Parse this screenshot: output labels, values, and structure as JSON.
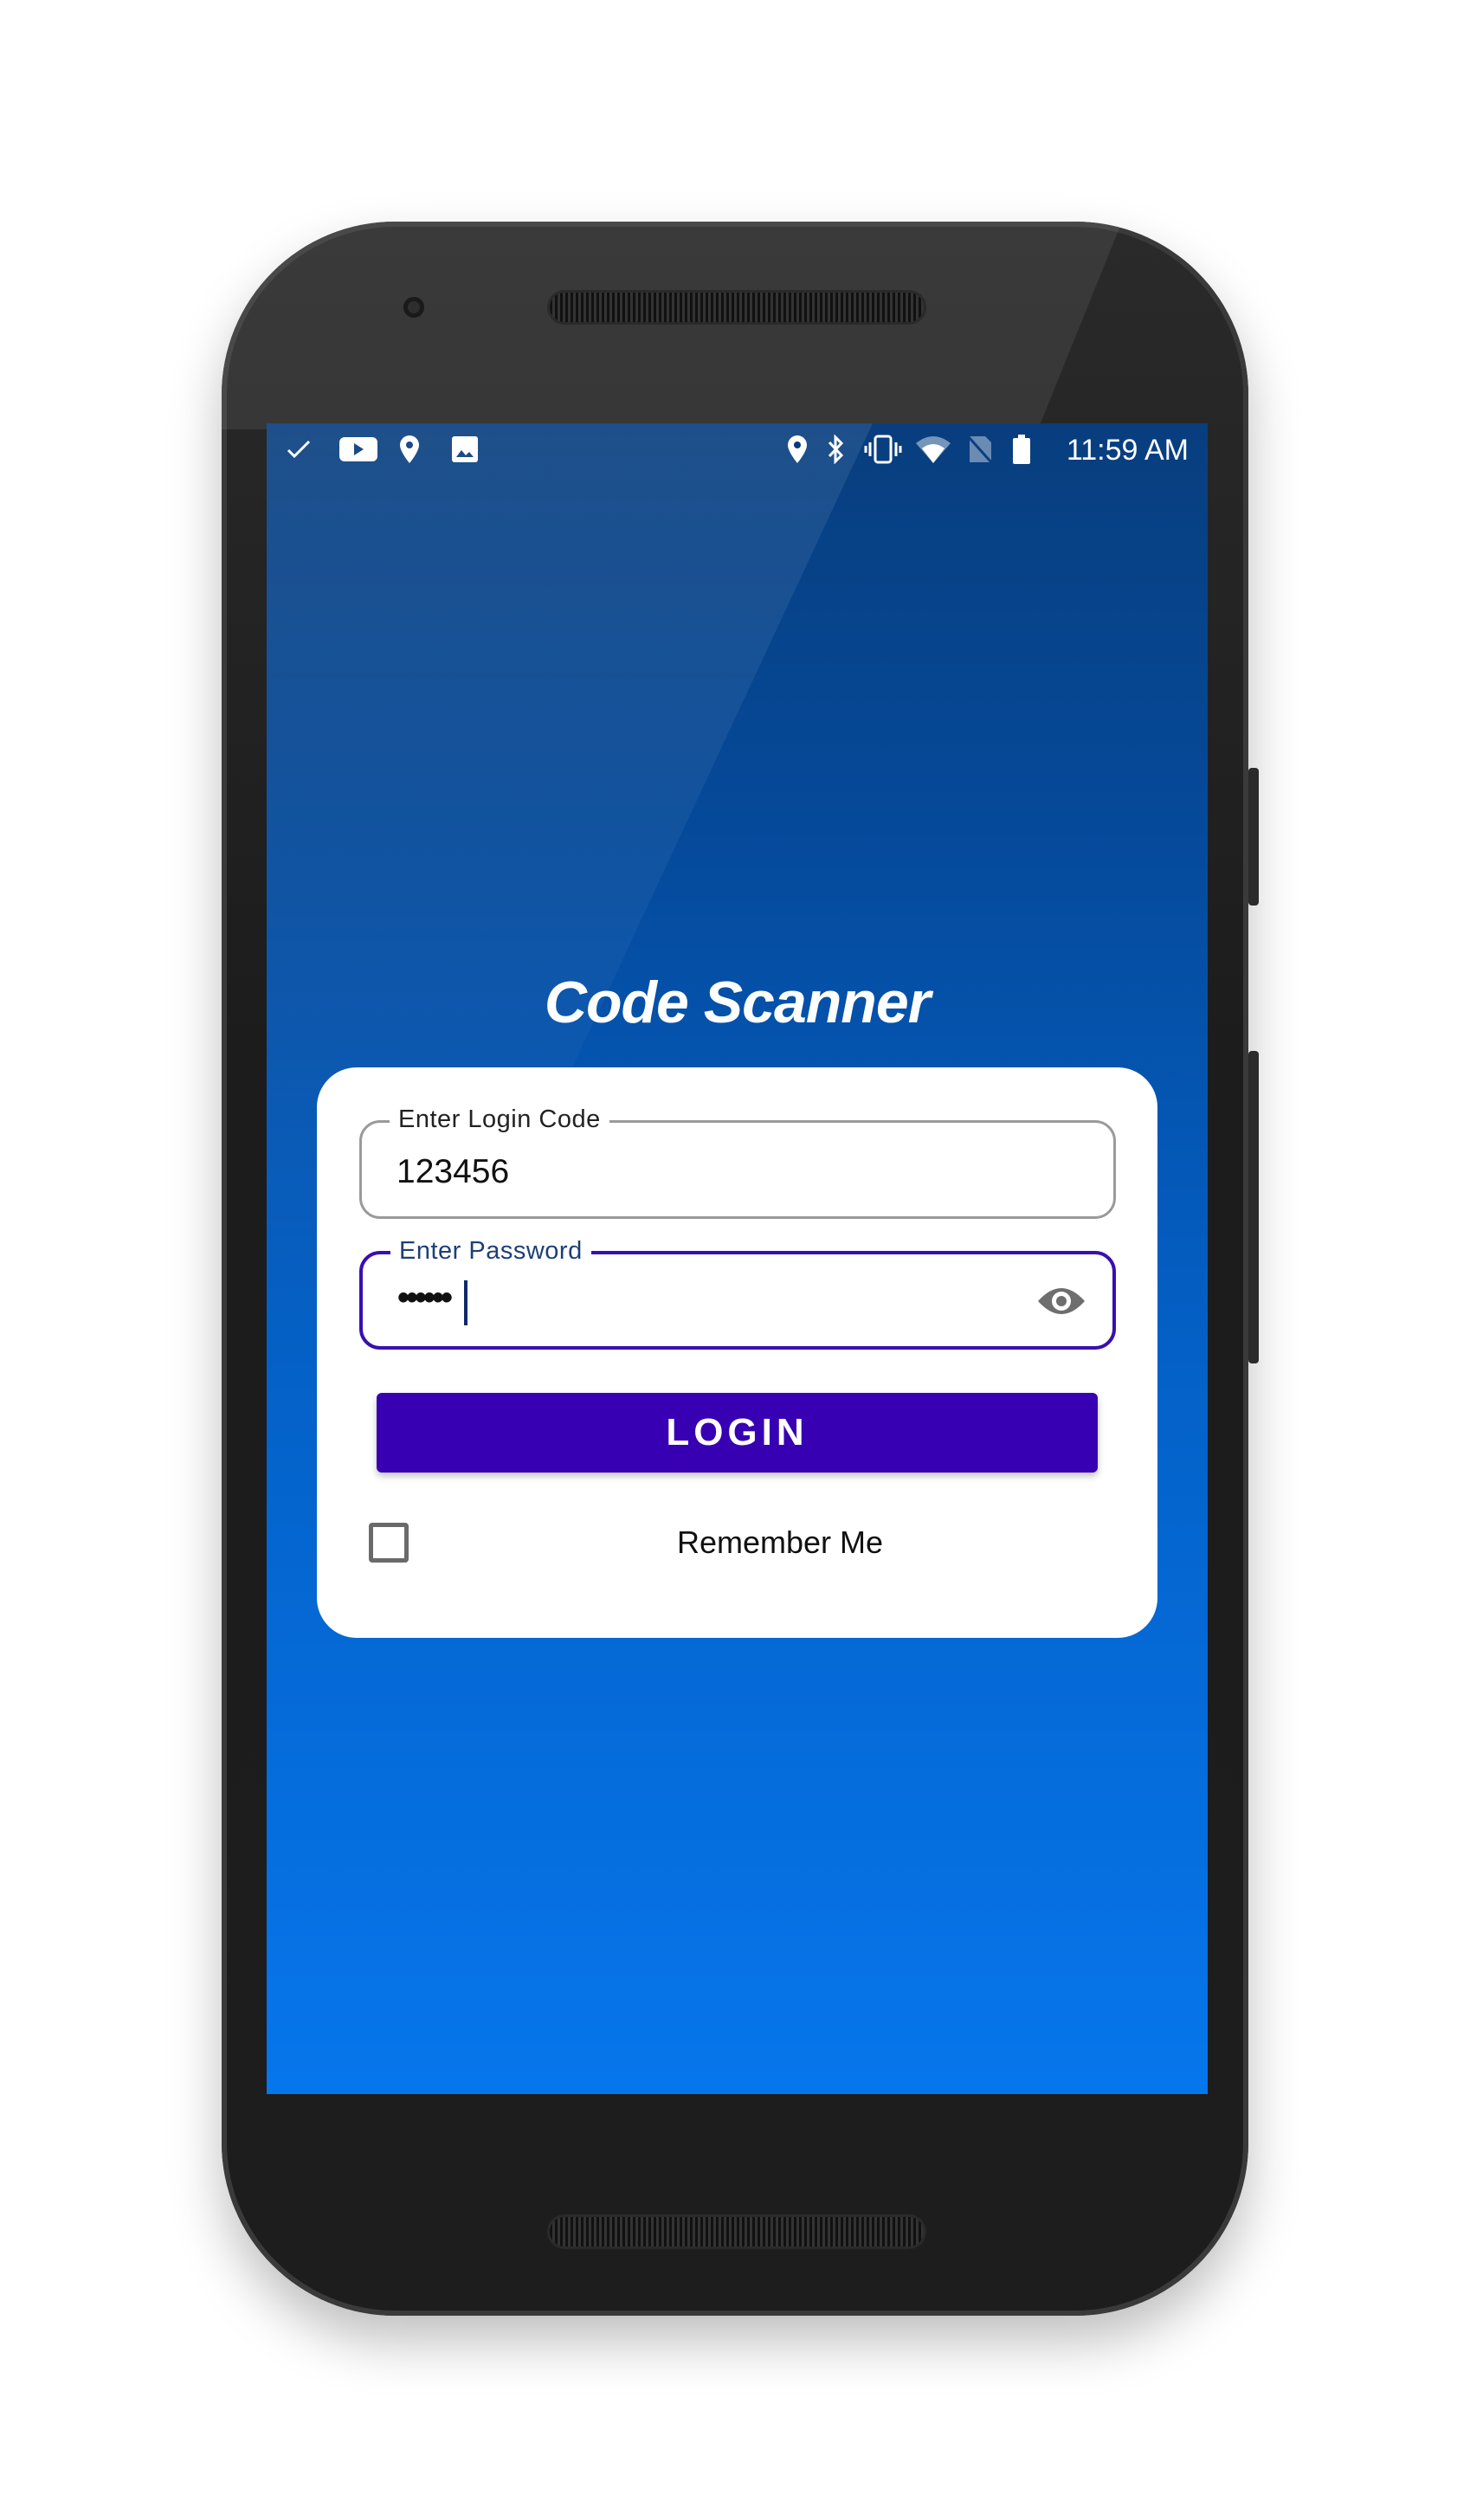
{
  "status_bar": {
    "left_icons": [
      "check-icon",
      "youtube-icon",
      "location-icon",
      "image-icon"
    ],
    "right_icons": [
      "location-icon",
      "bluetooth-icon",
      "vibrate-icon",
      "wifi-icon",
      "no-sim-icon",
      "battery-icon"
    ],
    "time": "11:59 AM"
  },
  "app": {
    "title": "Code Scanner",
    "login_code": {
      "label": "Enter Login Code",
      "value": "123456"
    },
    "password": {
      "label": "Enter Password",
      "value": "••••••",
      "toggle_icon": "eye-icon"
    },
    "login_button": "LOGIN",
    "remember_me": {
      "label": "Remember Me",
      "checked": false
    }
  },
  "colors": {
    "accent": "#3700b3",
    "background_top": "#083e7e",
    "background_bottom": "#0676ec"
  }
}
